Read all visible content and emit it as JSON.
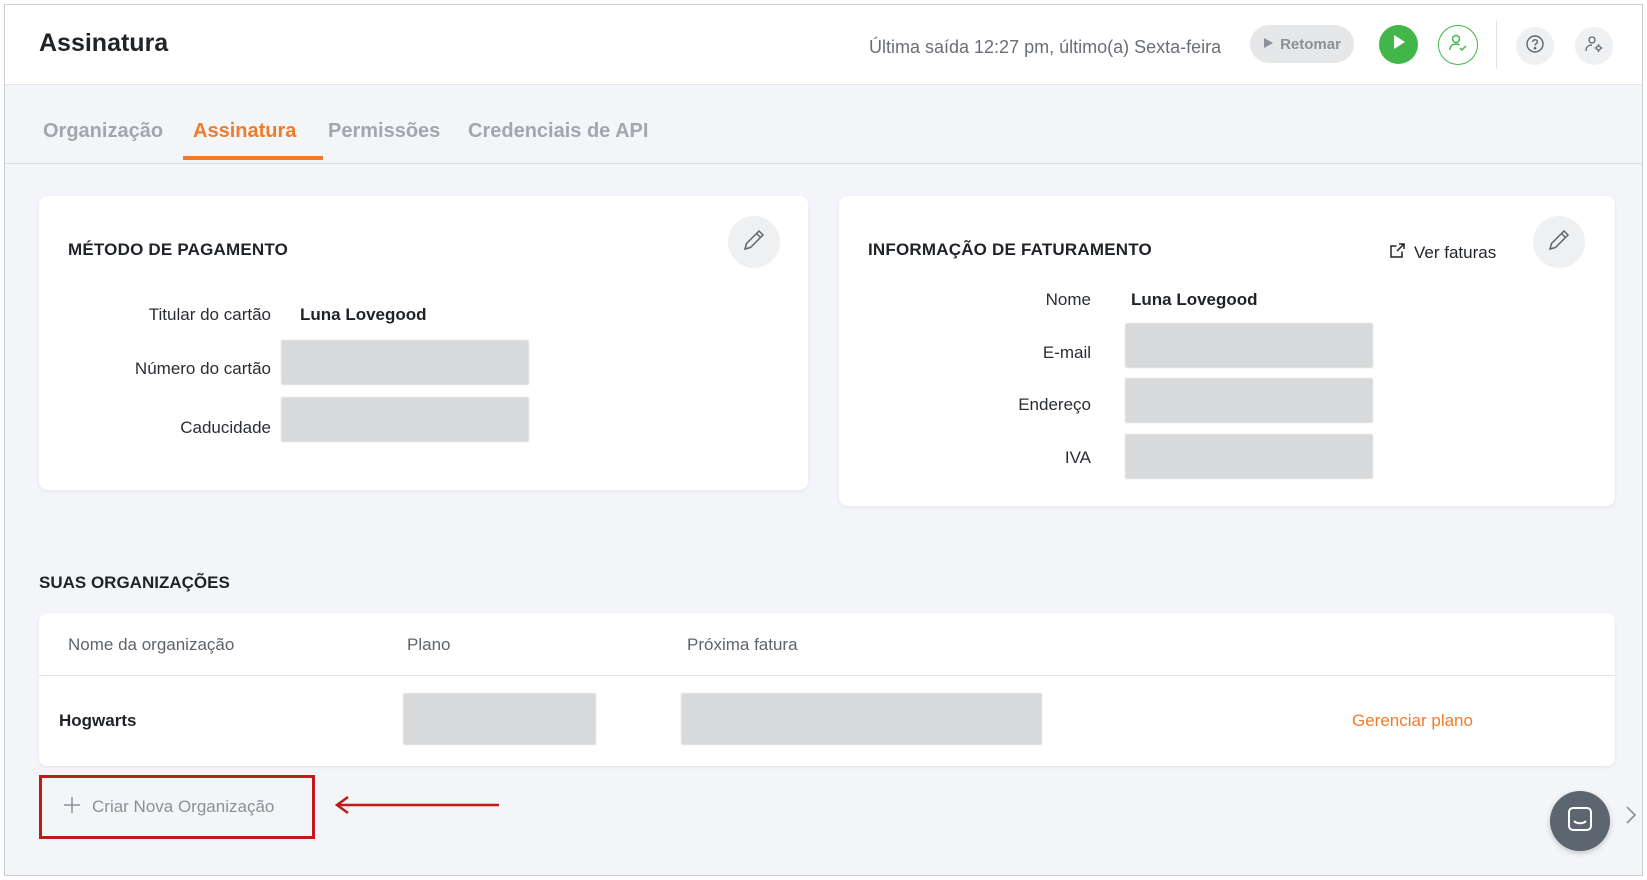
{
  "header": {
    "title": "Assinatura",
    "last_exit": "Última saída 12:27 pm, último(a) Sexta-feira",
    "resume_label": "Retomar",
    "icons": [
      "play-icon",
      "user-check-icon",
      "help-icon",
      "settings-icon"
    ]
  },
  "tabs": [
    {
      "label": "Organização",
      "active": false
    },
    {
      "label": "Assinatura",
      "active": true
    },
    {
      "label": "Permissões",
      "active": false
    },
    {
      "label": "Credenciais de API",
      "active": false
    }
  ],
  "payment": {
    "title": "MÉTODO DE PAGAMENTO",
    "holder_label": "Titular do cartão",
    "holder_value": "Luna Lovegood",
    "number_label": "Número do cartão",
    "expiry_label": "Caducidade"
  },
  "billing": {
    "title": "INFORMAÇÃO DE FATURAMENTO",
    "invoices_link": "Ver faturas",
    "name_label": "Nome",
    "name_value": "Luna Lovegood",
    "email_label": "E-mail",
    "address_label": "Endereço",
    "vat_label": "IVA"
  },
  "organizations": {
    "title": "SUAS ORGANIZAÇÕES",
    "columns": [
      "Nome da organização",
      "Plano",
      "Próxima fatura"
    ],
    "rows": [
      {
        "name": "Hogwarts",
        "action": "Gerenciar plano"
      }
    ],
    "create_label": "Criar Nova Organização"
  },
  "colors": {
    "accent": "#f07c2b",
    "green": "#43b649",
    "highlight": "#c01a1a"
  }
}
